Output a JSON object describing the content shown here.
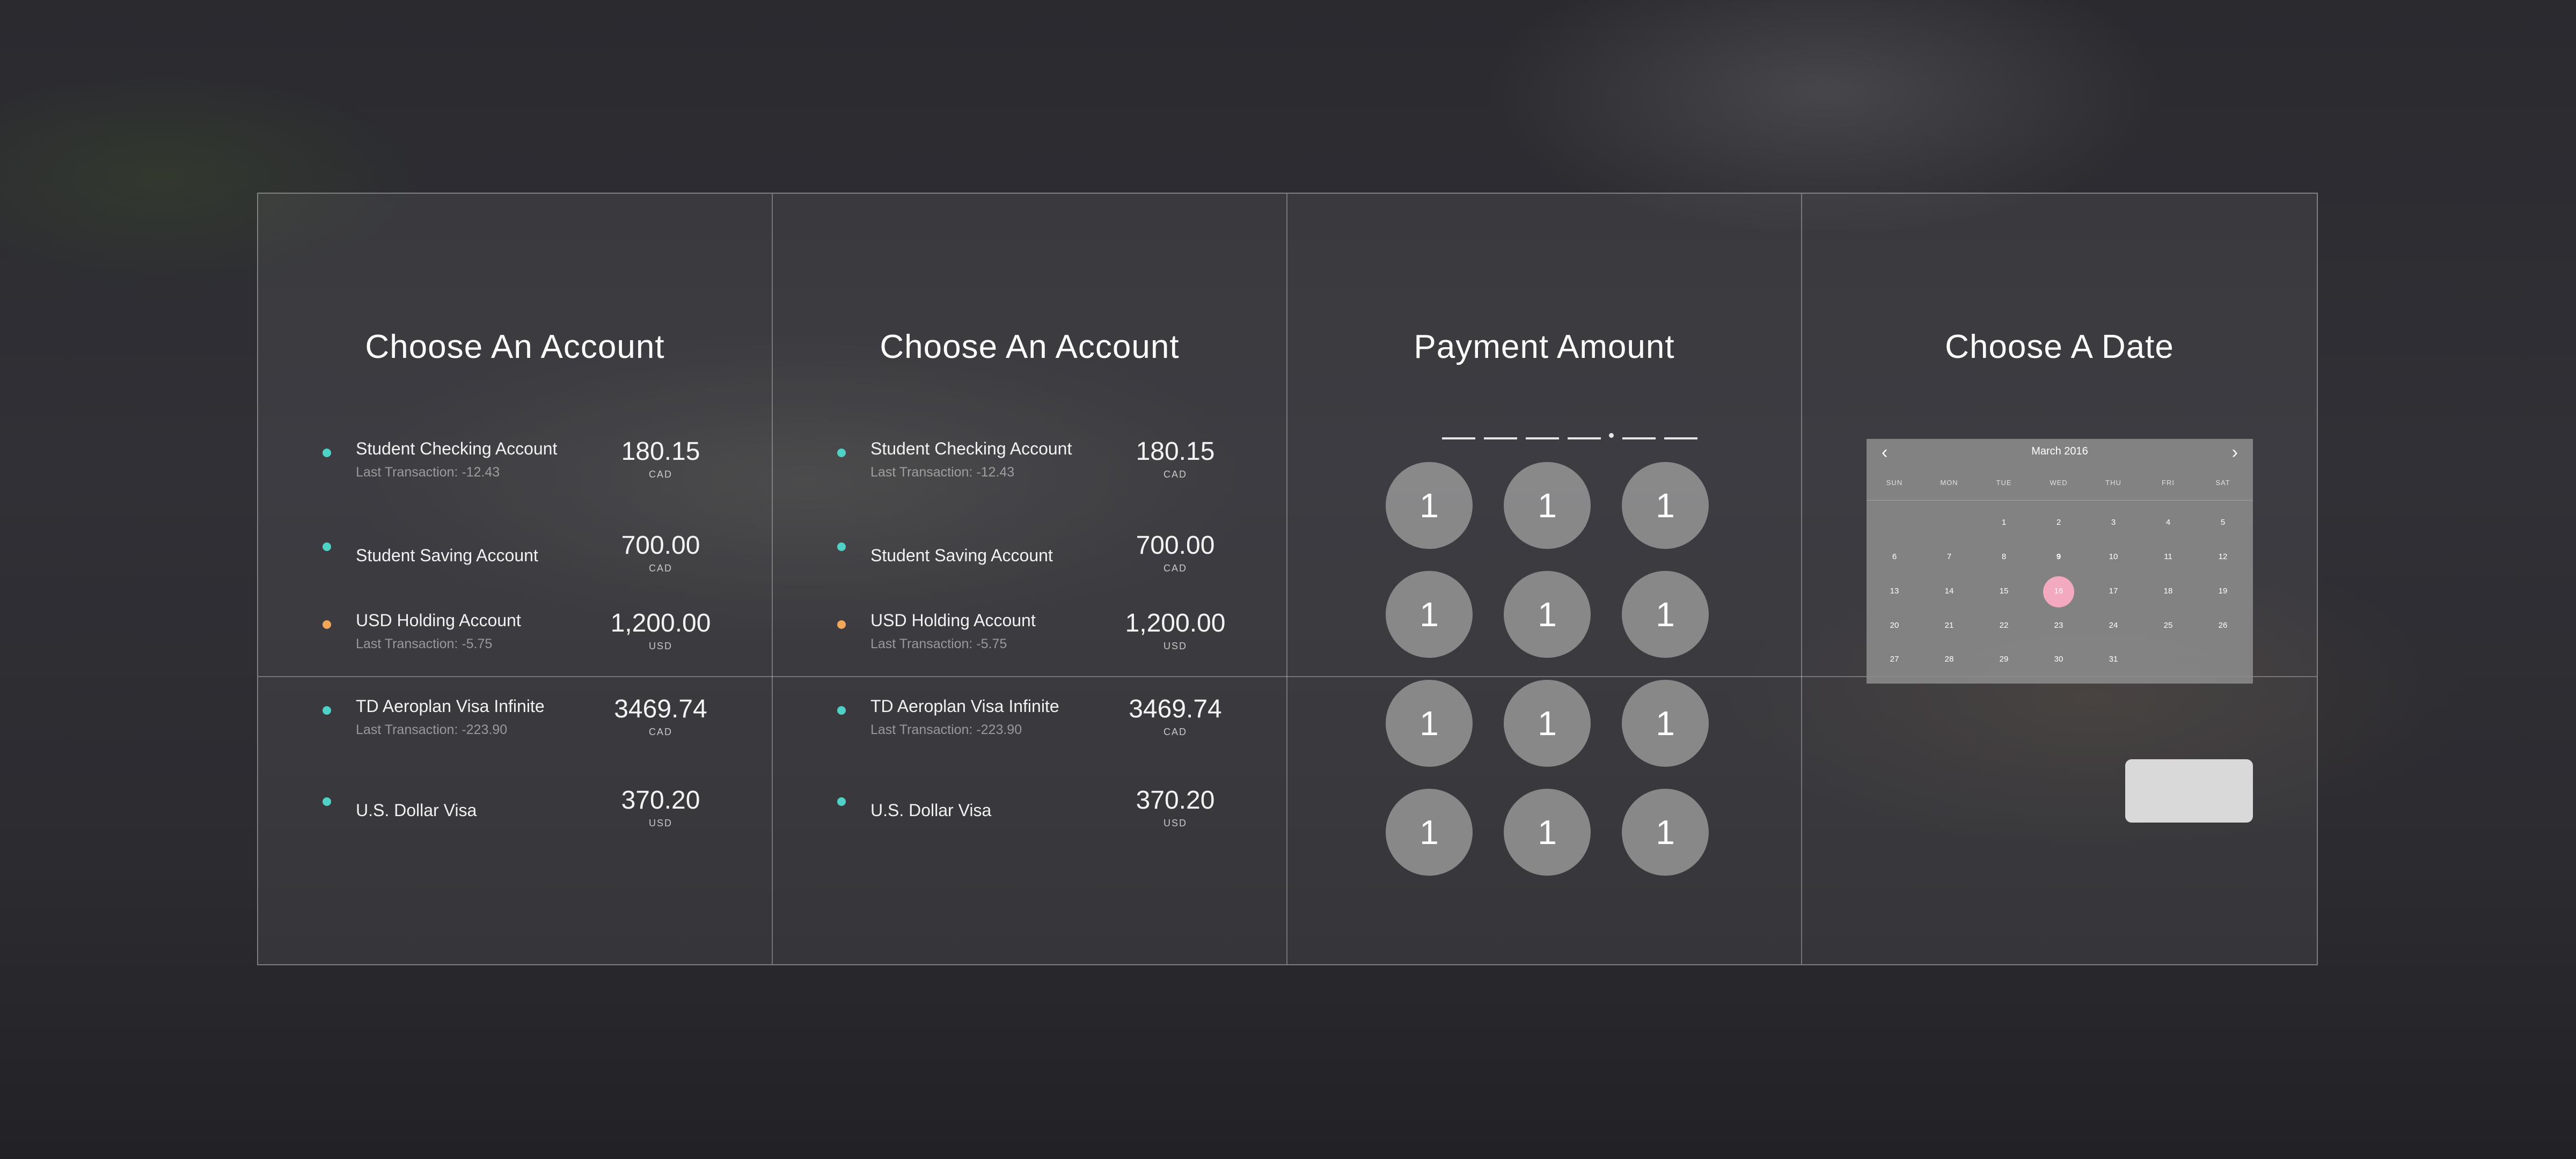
{
  "panels": [
    {
      "title": "Choose An Account",
      "accounts": [
        {
          "name": "Student Checking Account",
          "sub": "Last Transaction: -12.43",
          "amount": "180.15",
          "currency": "CAD",
          "color": "#4fd1c5"
        },
        {
          "name": "Student Saving Account",
          "sub": "",
          "amount": "700.00",
          "currency": "CAD",
          "color": "#4fd1c5"
        },
        {
          "name": "USD Holding Account",
          "sub": "Last Transaction: -5.75",
          "amount": "1,200.00",
          "currency": "USD",
          "color": "#f2a65a"
        },
        {
          "name": "TD Aeroplan Visa Infinite",
          "sub": "Last Transaction: -223.90",
          "amount": "3469.74",
          "currency": "CAD",
          "color": "#4fd1c5"
        },
        {
          "name": "U.S. Dollar Visa",
          "sub": "",
          "amount": "370.20",
          "currency": "USD",
          "color": "#4fd1c5"
        }
      ]
    },
    {
      "title": "Choose An Account",
      "accounts": [
        {
          "name": "Student Checking Account",
          "sub": "Last Transaction: -12.43",
          "amount": "180.15",
          "currency": "CAD",
          "color": "#4fd1c5"
        },
        {
          "name": "Student Saving Account",
          "sub": "",
          "amount": "700.00",
          "currency": "CAD",
          "color": "#4fd1c5"
        },
        {
          "name": "USD Holding Account",
          "sub": "Last Transaction: -5.75",
          "amount": "1,200.00",
          "currency": "USD",
          "color": "#f2a65a"
        },
        {
          "name": "TD Aeroplan Visa Infinite",
          "sub": "Last Transaction: -223.90",
          "amount": "3469.74",
          "currency": "CAD",
          "color": "#4fd1c5"
        },
        {
          "name": "U.S. Dollar Visa",
          "sub": "",
          "amount": "370.20",
          "currency": "USD",
          "color": "#4fd1c5"
        }
      ]
    }
  ],
  "payment": {
    "title": "Payment Amount",
    "keys": [
      "1",
      "1",
      "1",
      "1",
      "1",
      "1",
      "1",
      "1",
      "1",
      "1",
      "1",
      "1"
    ]
  },
  "date": {
    "title": "Choose A Date",
    "month": "March 2016",
    "prev_icon": "chevron-left-icon",
    "next_icon": "chevron-right-icon",
    "weekdays": [
      "SUN",
      "MON",
      "TUE",
      "WED",
      "THU",
      "FRI",
      "SAT"
    ],
    "weeks": [
      [
        "",
        "",
        "1",
        "2",
        "3",
        "4",
        "5"
      ],
      [
        "6",
        "7",
        "8",
        "9",
        "10",
        "11",
        "12"
      ],
      [
        "13",
        "14",
        "15",
        "16",
        "17",
        "18",
        "19"
      ],
      [
        "20",
        "21",
        "22",
        "23",
        "24",
        "25",
        "26"
      ],
      [
        "27",
        "28",
        "29",
        "30",
        "31",
        "",
        ""
      ]
    ],
    "today": "9",
    "selected": "16",
    "selected_color": "#f3a9c0"
  }
}
